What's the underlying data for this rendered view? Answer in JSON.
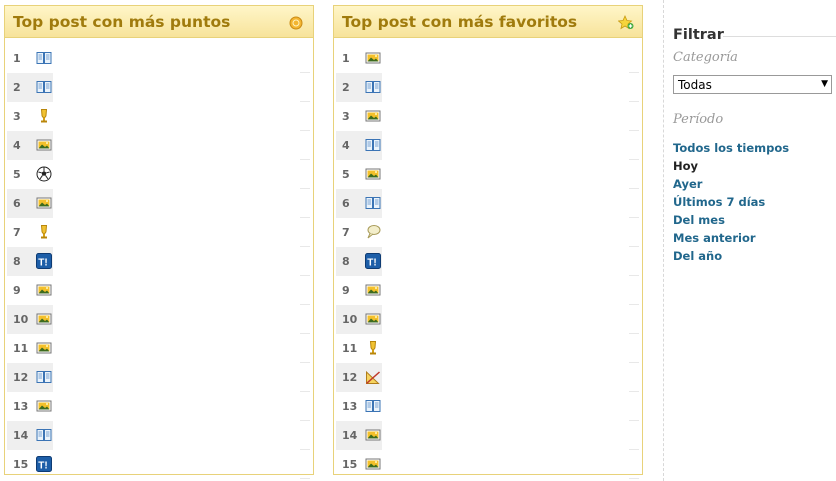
{
  "panels": [
    {
      "title": "Top post con más puntos",
      "header_icon": "coin-icon",
      "rows": [
        {
          "rank": "1",
          "icon": "book-icon"
        },
        {
          "rank": "2",
          "icon": "book-icon"
        },
        {
          "rank": "3",
          "icon": "trophy-icon"
        },
        {
          "rank": "4",
          "icon": "image-icon"
        },
        {
          "rank": "5",
          "icon": "soccer-ball-icon"
        },
        {
          "rank": "6",
          "icon": "image-icon"
        },
        {
          "rank": "7",
          "icon": "trophy-icon"
        },
        {
          "rank": "8",
          "icon": "taringa-icon"
        },
        {
          "rank": "9",
          "icon": "image-icon"
        },
        {
          "rank": "10",
          "icon": "image-icon"
        },
        {
          "rank": "11",
          "icon": "image-icon"
        },
        {
          "rank": "12",
          "icon": "book-icon"
        },
        {
          "rank": "13",
          "icon": "image-icon"
        },
        {
          "rank": "14",
          "icon": "book-icon"
        },
        {
          "rank": "15",
          "icon": "taringa-icon"
        }
      ]
    },
    {
      "title": "Top post con más favoritos",
      "header_icon": "star-add-icon",
      "rows": [
        {
          "rank": "1",
          "icon": "image-icon"
        },
        {
          "rank": "2",
          "icon": "book-icon"
        },
        {
          "rank": "3",
          "icon": "image-icon"
        },
        {
          "rank": "4",
          "icon": "book-icon"
        },
        {
          "rank": "5",
          "icon": "image-icon"
        },
        {
          "rank": "6",
          "icon": "book-icon"
        },
        {
          "rank": "7",
          "icon": "chat-bubble-icon"
        },
        {
          "rank": "8",
          "icon": "taringa-icon"
        },
        {
          "rank": "9",
          "icon": "image-icon"
        },
        {
          "rank": "10",
          "icon": "image-icon"
        },
        {
          "rank": "11",
          "icon": "trophy-icon"
        },
        {
          "rank": "12",
          "icon": "ruler-icon"
        },
        {
          "rank": "13",
          "icon": "book-icon"
        },
        {
          "rank": "14",
          "icon": "image-icon"
        },
        {
          "rank": "15",
          "icon": "image-icon"
        }
      ]
    }
  ],
  "filter": {
    "title": "Filtrar",
    "category_label": "Categoría",
    "category_value": "Todas",
    "period_label": "Período",
    "periods": [
      "Todos los tiempos",
      "Hoy",
      "Ayer",
      "Últimos 7 días",
      "Del mes",
      "Mes anterior",
      "Del año"
    ],
    "active_period": "Hoy"
  },
  "colors": {
    "header_title": "#a07b0d",
    "link": "#21678c",
    "panel_border": "#e8d27a"
  }
}
